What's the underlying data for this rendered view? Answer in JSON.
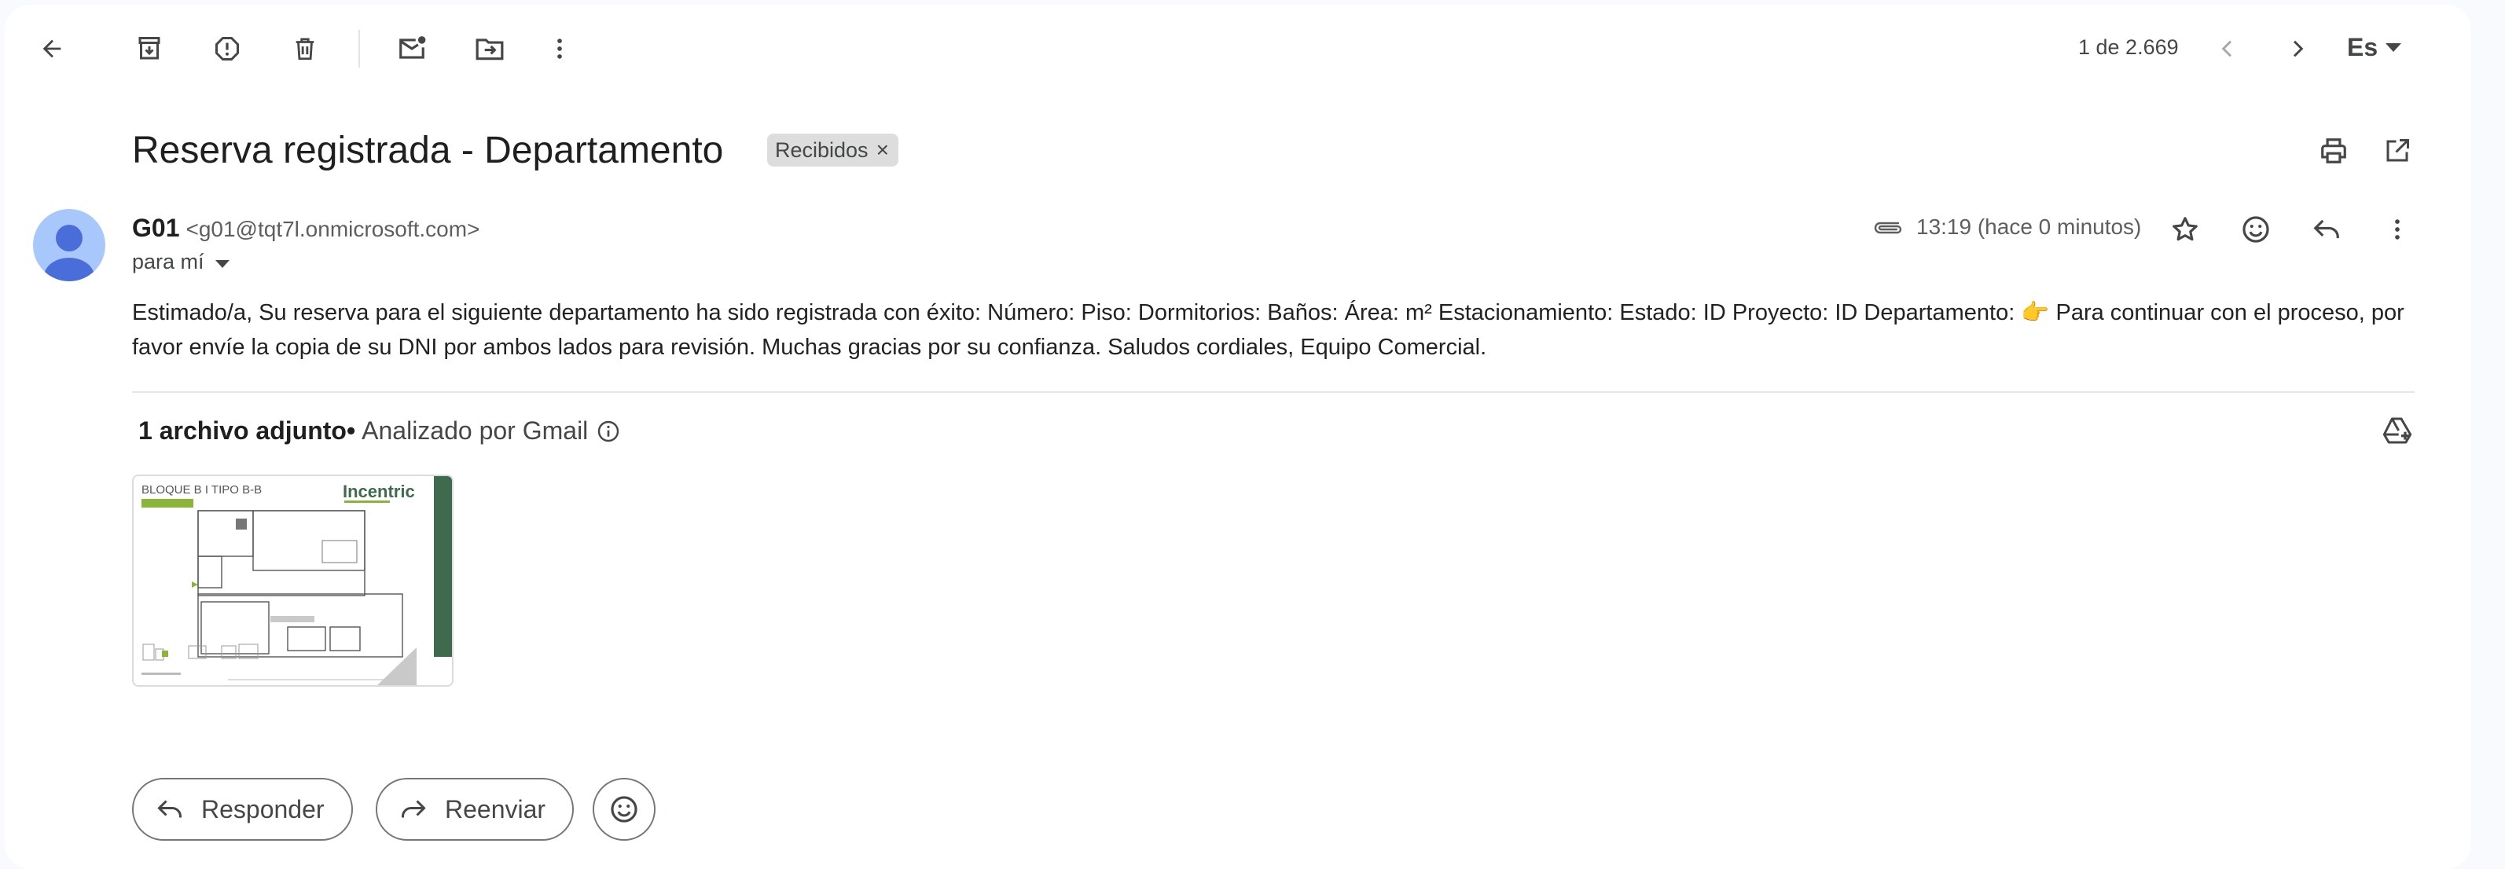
{
  "pagination": {
    "counter": "1 de 2.669"
  },
  "language": {
    "code": "Es"
  },
  "message": {
    "subject": "Reserva registrada - Departamento",
    "label": "Recibidos",
    "label_remove": "×",
    "sender_name": "G01",
    "sender_email": "<g01@tqt7l.onmicrosoft.com>",
    "to": "para mí",
    "time": "13:19 (hace 0 minutos)",
    "body": "Estimado/a, Su reserva para el siguiente departamento ha sido registrada con éxito: Número: Piso: Dormitorios: Baños: Área: m² Estacionamiento: Estado: ID Proyecto: ID Departamento: 👉 Para continuar con el proceso, por favor envíe la copia de su DNI por ambos lados para revisión. Muchas gracias por su confianza. Saludos cordiales, Equipo Comercial."
  },
  "attachments": {
    "count_label": "1 archivo adjunto",
    "separator": "•",
    "scanned_label": "Analizado por Gmail",
    "thumbnail": {
      "heading": "BLOQUE B I TIPO B-B",
      "brand": "Incentric",
      "brand_accent": "In"
    }
  },
  "actions": {
    "reply": "Responder",
    "forward": "Reenviar"
  },
  "icons": {
    "back": "arrow-left-icon",
    "archive": "archive-icon",
    "spam": "report-spam-icon",
    "delete": "trash-icon",
    "unread": "mark-unread-icon",
    "move": "move-to-icon",
    "more": "more-vert-icon",
    "prev": "chevron-left-icon",
    "next": "chevron-right-icon",
    "print": "print-icon",
    "open_new": "open-in-new-icon",
    "attachment": "paperclip-icon",
    "star": "star-icon",
    "emoji": "emoji-icon",
    "reply": "reply-icon",
    "forward": "forward-icon",
    "info": "info-icon",
    "drive": "add-to-drive-icon"
  },
  "colors": {
    "avatar_bg": "#a8c7fa",
    "avatar_fg": "#4a6ed9",
    "label_chip": "#dddddd",
    "brand_green": "#8ab43a",
    "panel_green": "#3f6a4e"
  }
}
